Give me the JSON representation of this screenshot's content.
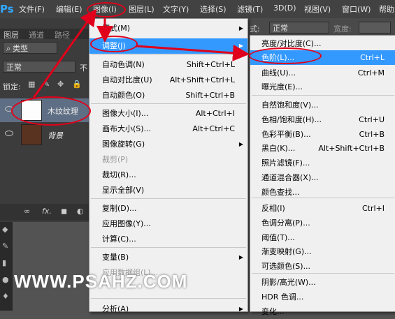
{
  "app": {
    "logo": "Ps"
  },
  "menubar": [
    "文件(F)",
    "编辑(E)",
    "图像(I)",
    "图层(L)",
    "文字(Y)",
    "选择(S)",
    "滤镜(T)",
    "3D(D)",
    "视图(V)",
    "窗口(W)",
    "帮助"
  ],
  "options_bar": {
    "style_label": "式:",
    "style_value": "正常",
    "width_label": "宽度:"
  },
  "panel": {
    "tabs": [
      "图层",
      "通道",
      "路径"
    ],
    "filter_kind": "类型",
    "blend_mode": "正常",
    "opacity_cut": "不",
    "lock_label": "锁定:",
    "layers": [
      {
        "name": "木纹纹理"
      },
      {
        "name": "背景"
      }
    ],
    "bottom_tools": [
      "∞",
      "fx.",
      "◼",
      "◐"
    ]
  },
  "image_menu": {
    "items": [
      {
        "label": "模式(M)",
        "shortcut": "",
        "submenu": true,
        "disabled": false,
        "highlighted": false
      },
      {
        "label": "调整(J)",
        "shortcut": "",
        "submenu": true,
        "disabled": false,
        "highlighted": true
      },
      {
        "label": "自动色调(N)",
        "shortcut": "Shift+Ctrl+L",
        "submenu": false,
        "disabled": false,
        "highlighted": false
      },
      {
        "label": "自动对比度(U)",
        "shortcut": "Alt+Shift+Ctrl+L",
        "submenu": false,
        "disabled": false,
        "highlighted": false
      },
      {
        "label": "自动颜色(O)",
        "shortcut": "Shift+Ctrl+B",
        "submenu": false,
        "disabled": false,
        "highlighted": false
      },
      {
        "label": "图像大小(I)...",
        "shortcut": "Alt+Ctrl+I",
        "submenu": false,
        "disabled": false,
        "highlighted": false
      },
      {
        "label": "画布大小(S)...",
        "shortcut": "Alt+Ctrl+C",
        "submenu": false,
        "disabled": false,
        "highlighted": false
      },
      {
        "label": "图像旋转(G)",
        "shortcut": "",
        "submenu": true,
        "disabled": false,
        "highlighted": false
      },
      {
        "label": "裁剪(P)",
        "shortcut": "",
        "submenu": false,
        "disabled": true,
        "highlighted": false
      },
      {
        "label": "裁切(R)...",
        "shortcut": "",
        "submenu": false,
        "disabled": false,
        "highlighted": false
      },
      {
        "label": "显示全部(V)",
        "shortcut": "",
        "submenu": false,
        "disabled": false,
        "highlighted": false
      },
      {
        "label": "复制(D)...",
        "shortcut": "",
        "submenu": false,
        "disabled": false,
        "highlighted": false
      },
      {
        "label": "应用图像(Y)...",
        "shortcut": "",
        "submenu": false,
        "disabled": false,
        "highlighted": false
      },
      {
        "label": "计算(C)...",
        "shortcut": "",
        "submenu": false,
        "disabled": false,
        "highlighted": false
      },
      {
        "label": "变量(B)",
        "shortcut": "",
        "submenu": true,
        "disabled": false,
        "highlighted": false
      },
      {
        "label": "应用数据组(L)...",
        "shortcut": "",
        "submenu": false,
        "disabled": true,
        "highlighted": false
      },
      {
        "label": "分析(A)",
        "shortcut": "",
        "submenu": true,
        "disabled": false,
        "highlighted": false
      }
    ]
  },
  "adjust_menu": {
    "items": [
      {
        "label": "亮度/对比度(C)...",
        "shortcut": "",
        "highlighted": false
      },
      {
        "label": "色阶(L)...",
        "shortcut": "Ctrl+L",
        "highlighted": true
      },
      {
        "label": "曲线(U)...",
        "shortcut": "Ctrl+M",
        "highlighted": false
      },
      {
        "label": "曝光度(E)...",
        "shortcut": "",
        "highlighted": false
      },
      {
        "label": "自然饱和度(V)...",
        "shortcut": "",
        "highlighted": false
      },
      {
        "label": "色相/饱和度(H)...",
        "shortcut": "Ctrl+U",
        "highlighted": false
      },
      {
        "label": "色彩平衡(B)...",
        "shortcut": "Ctrl+B",
        "highlighted": false
      },
      {
        "label": "黑白(K)...",
        "shortcut": "Alt+Shift+Ctrl+B",
        "highlighted": false
      },
      {
        "label": "照片滤镜(F)...",
        "shortcut": "",
        "highlighted": false
      },
      {
        "label": "通道混合器(X)...",
        "shortcut": "",
        "highlighted": false
      },
      {
        "label": "颜色查找...",
        "shortcut": "",
        "highlighted": false
      },
      {
        "label": "反相(I)",
        "shortcut": "Ctrl+I",
        "highlighted": false
      },
      {
        "label": "色调分离(P)...",
        "shortcut": "",
        "highlighted": false
      },
      {
        "label": "阈值(T)...",
        "shortcut": "",
        "highlighted": false
      },
      {
        "label": "渐变映射(G)...",
        "shortcut": "",
        "highlighted": false
      },
      {
        "label": "可选颜色(S)...",
        "shortcut": "",
        "highlighted": false
      },
      {
        "label": "阴影/高光(W)...",
        "shortcut": "",
        "highlighted": false
      },
      {
        "label": "HDR 色调...",
        "shortcut": "",
        "highlighted": false
      },
      {
        "label": "变化...",
        "shortcut": "",
        "highlighted": false
      }
    ]
  },
  "watermark": "WWW.PSAHZ.COM",
  "colors": {
    "annotation": "#e0001b",
    "highlight": "#3399ff",
    "wood_layer_thumb": "#5a3220"
  }
}
